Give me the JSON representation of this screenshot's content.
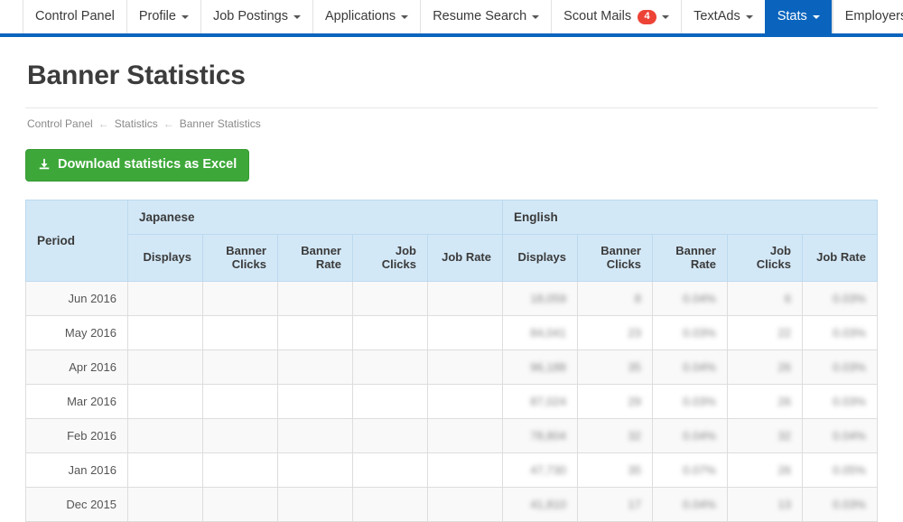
{
  "navbar": {
    "items": [
      {
        "label": "Control Panel",
        "has_caret": false,
        "active": false,
        "badge": null
      },
      {
        "label": "Profile",
        "has_caret": true,
        "active": false,
        "badge": null
      },
      {
        "label": "Job Postings",
        "has_caret": true,
        "active": false,
        "badge": null
      },
      {
        "label": "Applications",
        "has_caret": true,
        "active": false,
        "badge": null
      },
      {
        "label": "Resume Search",
        "has_caret": true,
        "active": false,
        "badge": null
      },
      {
        "label": "Scout Mails",
        "has_caret": true,
        "active": false,
        "badge": "4"
      },
      {
        "label": "TextAds",
        "has_caret": true,
        "active": false,
        "badge": null
      },
      {
        "label": "Stats",
        "has_caret": true,
        "active": true,
        "badge": null
      }
    ],
    "right_items": [
      {
        "label": "Employers",
        "has_caret": false,
        "active": false,
        "badge": null
      }
    ],
    "accent_color": "#0a64bd",
    "badge_color": "#ed4337"
  },
  "page": {
    "title": "Banner Statistics",
    "breadcrumb": [
      {
        "label": "Control Panel",
        "link": true
      },
      {
        "label": "Statistics",
        "link": true
      },
      {
        "label": "Banner Statistics",
        "link": false
      }
    ],
    "breadcrumb_separator": "←",
    "download_button": {
      "label": "Download statistics as Excel",
      "icon": "download-icon",
      "color": "#3da839"
    }
  },
  "table": {
    "period_header": "Period",
    "groups": [
      {
        "name": "Japanese"
      },
      {
        "name": "English"
      }
    ],
    "sub_headers": [
      "Displays",
      "Banner Clicks",
      "Banner Rate",
      "Job Clicks",
      "Job Rate"
    ],
    "rows": [
      {
        "period": "Jun 2016",
        "japanese": [
          "",
          "",
          "",
          "",
          ""
        ],
        "english": [
          "18,059",
          "8",
          "0.04%",
          "6",
          "0.03%"
        ]
      },
      {
        "period": "May 2016",
        "japanese": [
          "",
          "",
          "",
          "",
          ""
        ],
        "english": [
          "84,041",
          "23",
          "0.03%",
          "22",
          "0.03%"
        ]
      },
      {
        "period": "Apr 2016",
        "japanese": [
          "",
          "",
          "",
          "",
          ""
        ],
        "english": [
          "96,188",
          "35",
          "0.04%",
          "26",
          "0.03%"
        ]
      },
      {
        "period": "Mar 2016",
        "japanese": [
          "",
          "",
          "",
          "",
          ""
        ],
        "english": [
          "87,024",
          "29",
          "0.03%",
          "26",
          "0.03%"
        ]
      },
      {
        "period": "Feb 2016",
        "japanese": [
          "",
          "",
          "",
          "",
          ""
        ],
        "english": [
          "78,804",
          "32",
          "0.04%",
          "32",
          "0.04%"
        ]
      },
      {
        "period": "Jan 2016",
        "japanese": [
          "",
          "",
          "",
          "",
          ""
        ],
        "english": [
          "47,730",
          "35",
          "0.07%",
          "26",
          "0.05%"
        ]
      },
      {
        "period": "Dec 2015",
        "japanese": [
          "",
          "",
          "",
          "",
          ""
        ],
        "english": [
          "41,810",
          "17",
          "0.04%",
          "13",
          "0.03%"
        ]
      }
    ]
  }
}
